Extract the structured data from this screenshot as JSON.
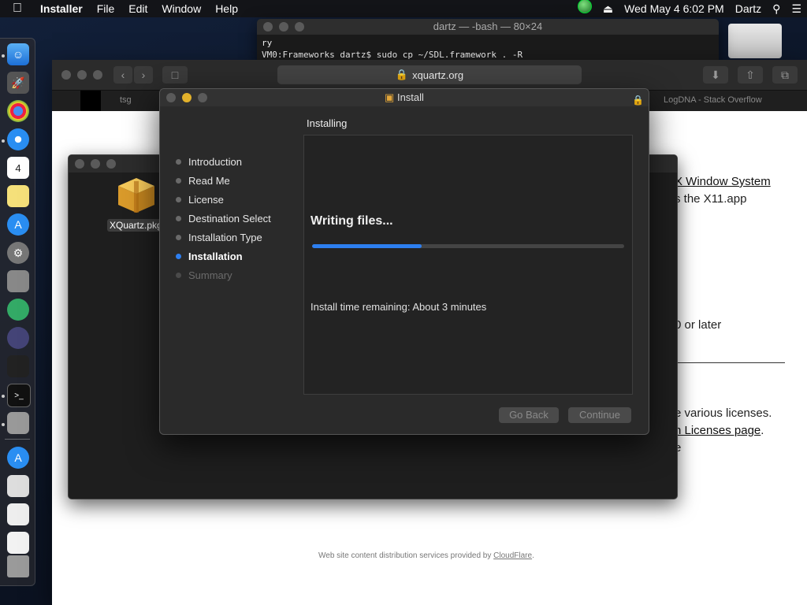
{
  "menubar": {
    "apple": "",
    "app": "Installer",
    "items": [
      "File",
      "Edit",
      "Window",
      "Help"
    ],
    "clock": "Wed May 4  6:02 PM",
    "user": "Dartz"
  },
  "terminal": {
    "title": "dartz — -bash — 80×24",
    "line1": "ry",
    "line2": "VM0:Frameworks dartz$ sudo cp ~/SDL.framework . -R"
  },
  "safari": {
    "url": "xquartz.org",
    "tab_left": "tsg",
    "tab_right": "LogDNA - Stack Overflow",
    "web": {
      "link1": "X Window System",
      "text1": "s the X11.app",
      "text2": "0 or later",
      "text3": "e various licenses.",
      "link2": "n Licenses page",
      "text3_tail": ".",
      "text4": "e",
      "footer_text": "Web site content distribution services provided by ",
      "footer_link": "CloudFlare",
      "footer_tail": "."
    }
  },
  "finder": {
    "file_label": "XQuartz.pkg"
  },
  "installer": {
    "title": "Install",
    "section": "Installing",
    "steps": [
      {
        "label": "Introduction"
      },
      {
        "label": "Read Me"
      },
      {
        "label": "License"
      },
      {
        "label": "Destination Select"
      },
      {
        "label": "Installation Type"
      },
      {
        "label": "Installation"
      },
      {
        "label": "Summary"
      }
    ],
    "status": "Writing files...",
    "progress": 0.35,
    "remaining": "Install time remaining: About 3 minutes",
    "back_label": "Go Back",
    "continue_label": "Continue"
  },
  "colors": {
    "accent": "#2d7ff0"
  }
}
